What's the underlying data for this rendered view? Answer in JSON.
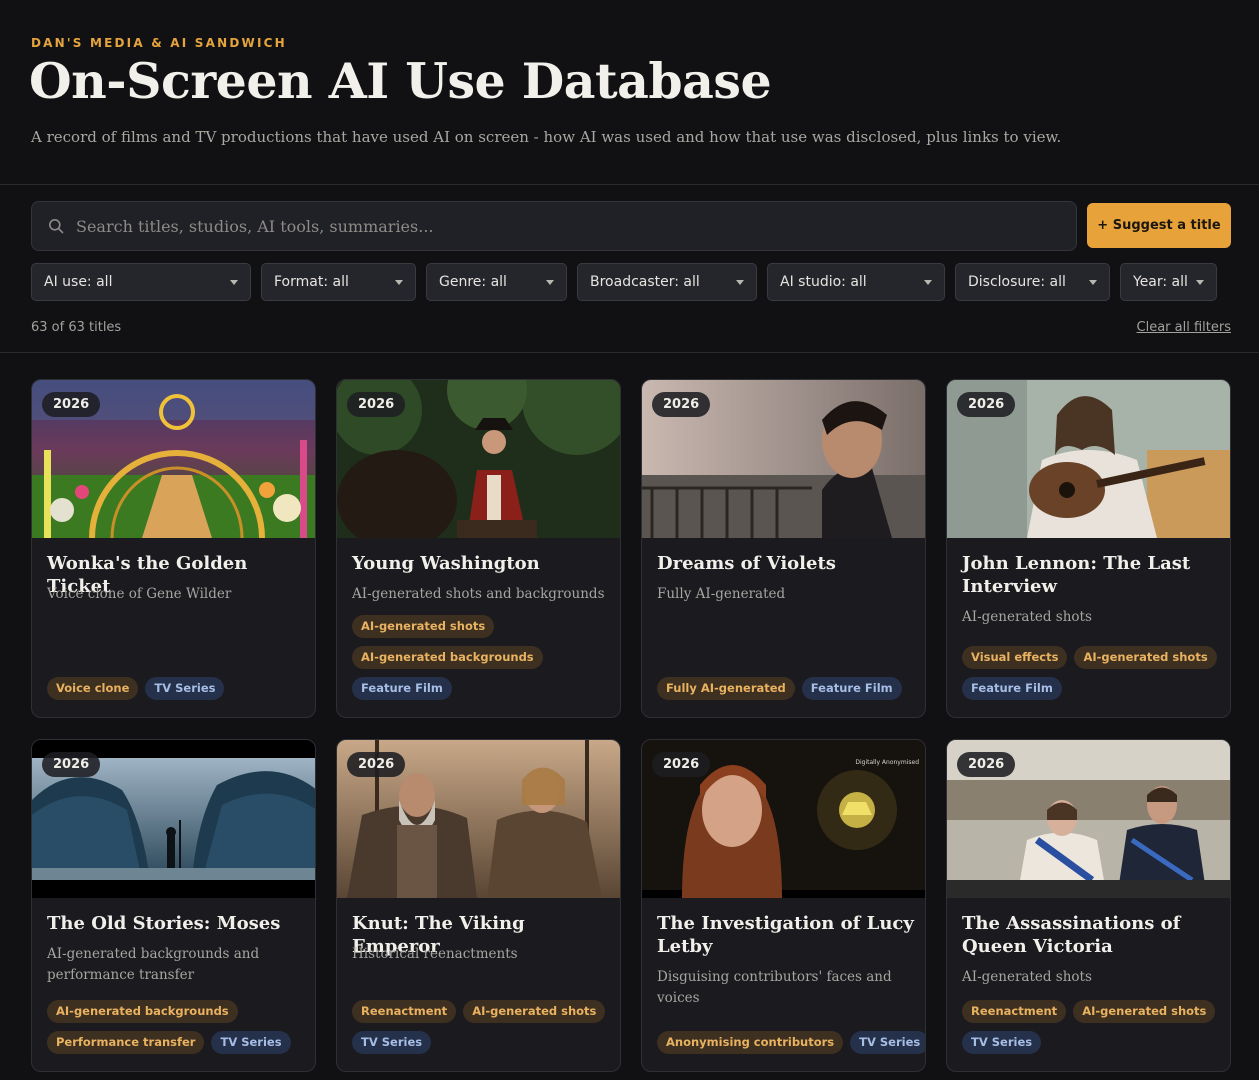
{
  "header": {
    "eyebrow": "DAN'S MEDIA & AI SANDWICH",
    "title": "On-Screen AI Use Database",
    "subtitle": "A record of films and TV productions that have used AI on screen - how AI was used and how that use was disclosed, plus links to view."
  },
  "search": {
    "placeholder": "Search titles, studios, AI tools, summaries..."
  },
  "suggest_label": "+ Suggest a title",
  "filters": [
    {
      "label": "AI use: all"
    },
    {
      "label": "Format: all"
    },
    {
      "label": "Genre: all"
    },
    {
      "label": "Broadcaster: all"
    },
    {
      "label": "AI studio: all"
    },
    {
      "label": "Disclosure: all"
    },
    {
      "label": "Year: all"
    }
  ],
  "results_count": "63 of 63 titles",
  "clear_label": "Clear all filters",
  "colors": {
    "accent": "#e8a23a",
    "background": "#111114",
    "card": "#1a1a1f"
  },
  "cards": [
    {
      "year": "2026",
      "title": "Wonka's the Golden Ticket",
      "desc": "Voice clone of Gene Wilder",
      "tag_rows": [
        [
          {
            "label": "Voice clone",
            "kind": "ai"
          },
          {
            "label": "TV Series",
            "kind": "fmt"
          }
        ]
      ]
    },
    {
      "year": "2026",
      "title": "Young Washington",
      "desc": "AI-generated shots and backgrounds",
      "tag_rows": [
        [
          {
            "label": "AI-generated shots",
            "kind": "ai"
          }
        ],
        [
          {
            "label": "AI-generated backgrounds",
            "kind": "ai"
          }
        ],
        [
          {
            "label": "Feature Film",
            "kind": "fmt"
          }
        ]
      ]
    },
    {
      "year": "2026",
      "title": "Dreams of Violets",
      "desc": "Fully AI-generated",
      "tag_rows": [
        [
          {
            "label": "Fully AI-generated",
            "kind": "ai"
          },
          {
            "label": "Feature Film",
            "kind": "fmt"
          }
        ]
      ]
    },
    {
      "year": "2026",
      "title": "John Lennon: The Last Interview",
      "desc": "AI-generated shots",
      "tag_rows": [
        [
          {
            "label": "Visual effects",
            "kind": "ai"
          },
          {
            "label": "AI-generated shots",
            "kind": "ai"
          }
        ],
        [
          {
            "label": "Feature Film",
            "kind": "fmt"
          }
        ]
      ]
    },
    {
      "year": "2026",
      "title": "The Old Stories: Moses",
      "desc": "AI-generated backgrounds and performance transfer",
      "tag_rows": [
        [
          {
            "label": "AI-generated backgrounds",
            "kind": "ai"
          }
        ],
        [
          {
            "label": "Performance transfer",
            "kind": "ai"
          },
          {
            "label": "TV Series",
            "kind": "fmt"
          }
        ]
      ]
    },
    {
      "year": "2026",
      "title": "Knut: The Viking Emperor",
      "desc": "Historical reenactments",
      "tag_rows": [
        [
          {
            "label": "Reenactment",
            "kind": "ai"
          },
          {
            "label": "AI-generated shots",
            "kind": "ai"
          }
        ],
        [
          {
            "label": "TV Series",
            "kind": "fmt"
          }
        ]
      ]
    },
    {
      "year": "2026",
      "title": "The Investigation of Lucy Letby",
      "desc": "Disguising contributors' faces and voices",
      "overlay_text": "Digitally Anonymised",
      "tag_rows": [
        [
          {
            "label": "Anonymising contributors",
            "kind": "ai"
          },
          {
            "label": "TV Series",
            "kind": "fmt"
          }
        ]
      ]
    },
    {
      "year": "2026",
      "title": "The Assassinations of Queen Victoria",
      "desc": "AI-generated shots",
      "tag_rows": [
        [
          {
            "label": "Reenactment",
            "kind": "ai"
          },
          {
            "label": "AI-generated shots",
            "kind": "ai"
          }
        ],
        [
          {
            "label": "TV Series",
            "kind": "fmt"
          }
        ]
      ]
    }
  ]
}
